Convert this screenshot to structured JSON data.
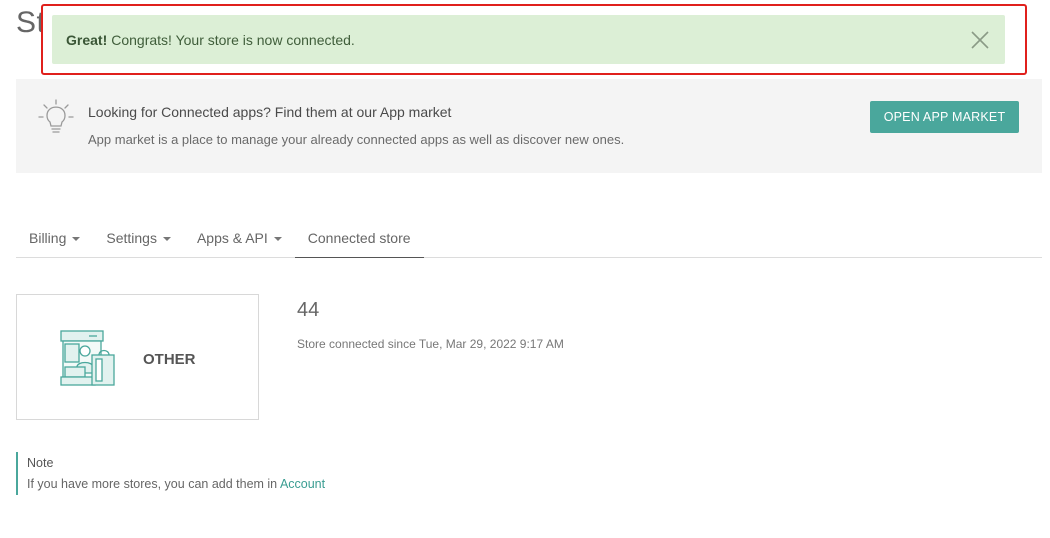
{
  "page": {
    "title": "Store"
  },
  "alert": {
    "strong": "Great!",
    "message": "Congrats! Your store is now connected.",
    "close_icon": "close-icon",
    "colors": {
      "background": "#dcefd6",
      "highlight_border": "#e0201c"
    }
  },
  "info_panel": {
    "icon": "lightbulb-icon",
    "title": "Looking for Connected apps? Find them at our App market",
    "subtitle": "App market is a place to manage your already connected apps as well as discover new ones.",
    "button_label": "OPEN APP MARKET",
    "button_color": "#4aa79c"
  },
  "tabs": [
    {
      "label": "Billing",
      "dropdown": true
    },
    {
      "label": "Settings",
      "dropdown": true
    },
    {
      "label": "Apps & API",
      "dropdown": true
    },
    {
      "label": "Connected store",
      "dropdown": false,
      "active": true
    }
  ],
  "store": {
    "type_label": "OTHER",
    "icon": "store-illustration-icon",
    "id": "44",
    "connected_since": "Store connected since Tue, Mar 29, 2022 9:17 AM"
  },
  "note": {
    "title": "Note",
    "text": "If you have more stores, you can add them in",
    "link_label": "Account"
  }
}
